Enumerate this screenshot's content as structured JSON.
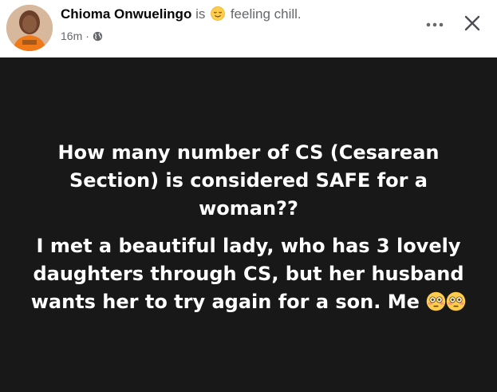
{
  "post": {
    "author": {
      "name": "Chioma Onwuelingo",
      "is_word": "is",
      "feeling_emoji": "relieved-face-emoji",
      "feeling_text": "feeling chill."
    },
    "time": "16m",
    "separator": "·",
    "privacy_icon": "globe-icon",
    "actions": {
      "more": "more-options-icon",
      "close": "close-icon"
    },
    "body": {
      "background": "#181818",
      "text_color": "#ffffff",
      "question": "How many number of CS (Cesarean Section) is considered SAFE for a woman??",
      "story": "I met a beautiful lady, who has 3 lovely daughters through CS, but her husband wants her to try again for a son. Me",
      "trailing_emojis": [
        "flushed-face-emoji",
        "flushed-face-emoji"
      ]
    }
  }
}
